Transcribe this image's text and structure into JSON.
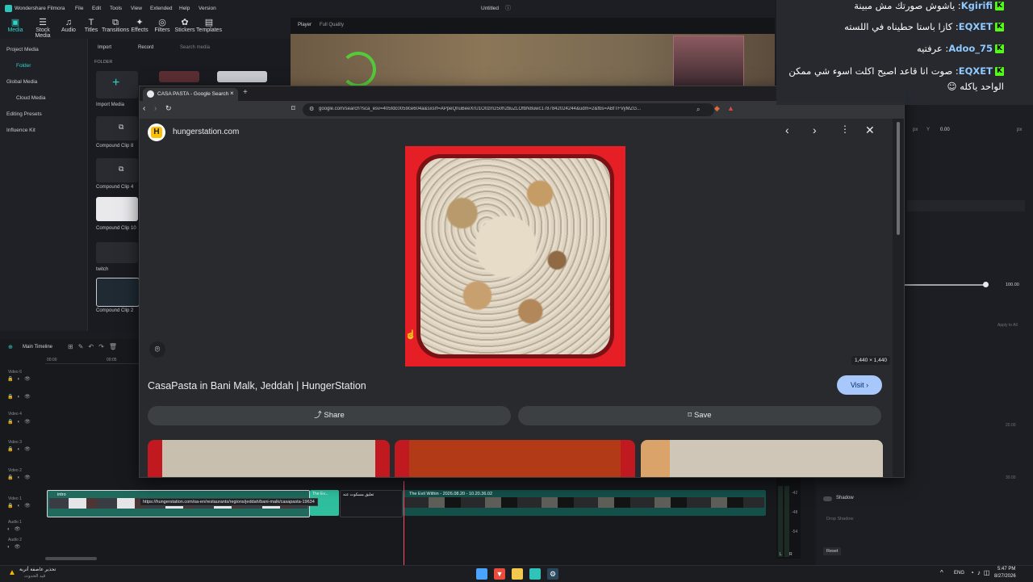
{
  "filmora": {
    "app_title": "Wondershare Filmora",
    "menu": [
      "File",
      "Edit",
      "Tools",
      "View",
      "Extended",
      "Help",
      "Version"
    ],
    "project_title": "Untitled",
    "tools": [
      "Media",
      "Stock Media",
      "Audio",
      "Titles",
      "Transitions",
      "Effects",
      "Filters",
      "Stickers",
      "Templates"
    ],
    "sidebar": [
      "Project Media",
      "Folder",
      "Global Media",
      "Cloud Media",
      "Editing Presets",
      "Influence Kit"
    ],
    "media_toolbar": {
      "import": "Import",
      "record": "Record",
      "search_placeholder": "Search media"
    },
    "folder_label": "FOLDER",
    "media_items": [
      "Import Media",
      "Compound Clip 8",
      "Compound Clip 4",
      "Compound Clip 10",
      "twitch",
      "Compound Clip 2"
    ],
    "player": {
      "label": "Player",
      "quality": "Full Quality"
    },
    "timeline": {
      "label": "Main Timeline",
      "time_start": "00:00",
      "time_mark": "00:05",
      "tracks": [
        "Video 6",
        "Video 5",
        "Video 4",
        "Video 3",
        "Video 2",
        "Video 1",
        "Audio 1",
        "Audio 2"
      ],
      "clips": [
        "intro",
        "The Ev...",
        "تعليق مسكوت عنه",
        "The Evil Within - 2026.08.20 - 10.20.36.02"
      ],
      "db_marks": [
        "-42",
        "-48",
        "-54"
      ],
      "meter_lr": [
        "L",
        "R"
      ]
    },
    "props": {
      "x_label": "px",
      "y_label": "Y",
      "y_value": "0.00",
      "y_unit": "px",
      "scale_value": "100.00",
      "shadow_label": "Shadow",
      "drop_shadow": "Drop Shadow",
      "reset_label": "Reset",
      "value_a": "20.00",
      "value_b": "30.00",
      "apply_label": "Apply to All"
    }
  },
  "chrome": {
    "tab_title": "CASA PASTA - Google Search",
    "url": "google.com/search?sca_esv=405fdc0059ce604a&sxsrf=APpeQnuBeeXrU1O0zm250h2buZLOfbN8uwc1787842024244&udm=2&fbs=ABfTFVyMZG...",
    "source_domain": "hungerstation.com",
    "source_logo_letter": "H",
    "image_dimensions": "1,440 × 1,440",
    "result_title": "CasaPasta in Bani Malk, Jeddah | HungerStation",
    "visit_label": "Visit",
    "share_label": "Share",
    "save_label": "Save",
    "status_url": "https://hungerstation.com/sa-en/restaurants/regions/jeddah/bani-malk/casapasta-19634"
  },
  "chat": [
    {
      "user": "Kgirifi",
      "message": "ياشوش صورتك مش مبينة",
      "color": "#8fc9ff"
    },
    {
      "user": "EQXET",
      "message": "كازا باستا حطيناه في اللسته",
      "color": "#8fc9ff"
    },
    {
      "user": "Adoo_75",
      "message": "عرفتيه",
      "color": "#8fc9ff"
    },
    {
      "user": "EQXET",
      "message": "صوت انا قاعد اصيح اكلت اسوء شي ممكن",
      "color": "#8fc9ff"
    },
    {
      "user": "",
      "message": "الواحد ياكله",
      "color": "#8fc9ff"
    }
  ],
  "taskbar": {
    "weather_title": "تحذير عاصفة أتربة",
    "weather_sub": "قيد الحدوث",
    "lang": "ENG",
    "time": "5:47 PM",
    "date": "8/27/2026"
  },
  "colors": {
    "kick_green": "#53fc18",
    "visit_blue": "#a8c7fa",
    "image_bg_red": "#e51f25"
  }
}
